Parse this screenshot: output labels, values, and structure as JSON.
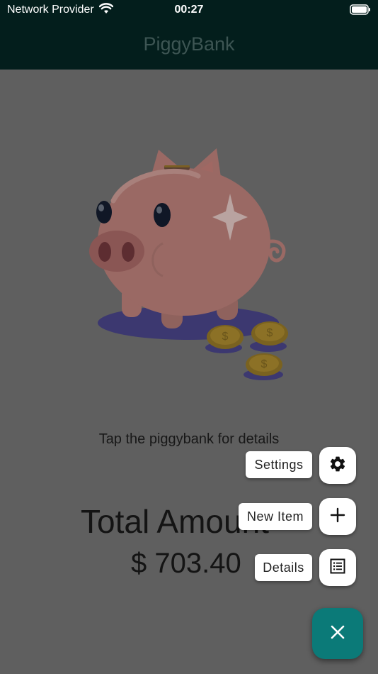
{
  "status_bar": {
    "carrier": "Network Provider",
    "time": "00:27",
    "icons": [
      "wifi-icon",
      "battery-icon"
    ]
  },
  "app_bar": {
    "title": "PiggyBank"
  },
  "main": {
    "hint": "Tap the piggybank for details",
    "total_label": "Total Amount",
    "total_value": "$ 703.40"
  },
  "speed_dial": {
    "items": [
      {
        "label": "Settings",
        "icon": "gear-icon"
      },
      {
        "label": "New Item",
        "icon": "plus-icon"
      },
      {
        "label": "Details",
        "icon": "list-icon"
      }
    ],
    "toggle_icon": "close-icon"
  },
  "colors": {
    "app_bar": "#031e1c",
    "scrim_background": "#5f5f5f",
    "fab": "#0b7a78",
    "title_text": "#3d5553"
  }
}
